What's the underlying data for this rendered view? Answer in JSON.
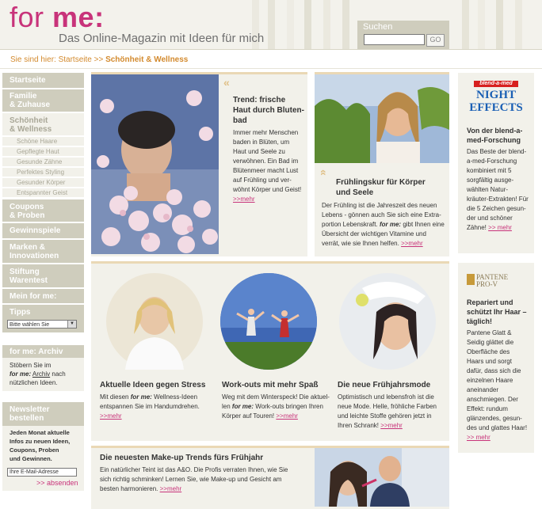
{
  "header": {
    "logo_left": "for",
    "logo_right": "me:",
    "tagline": "Das Online-Magazin mit Ideen für mich",
    "search_label": "Suchen",
    "search_button": "GO"
  },
  "breadcrumb": {
    "prefix": "Sie sind hier: Startseite >> ",
    "current": "Schönheit & Wellness"
  },
  "sidebar": {
    "startseite": "Startseite",
    "familie_1": "Familie",
    "familie_2": "& Zuhause",
    "schoenheit_1": "Schönheit",
    "schoenheit_2": "& Wellness",
    "subs": [
      "Schöne Haare",
      "Gepflegte Haut",
      "Gesunde Zähne",
      "Perfektes Styling",
      "Gesunder Körper",
      "Entspannter Geist"
    ],
    "coupons_1": "Coupons",
    "coupons_2": "& Proben",
    "gewinnspiele": "Gewinnspiele",
    "marken_1": "Marken &",
    "marken_2": "Innovationen",
    "stiftung_1": "Stiftung",
    "stiftung_2": "Warentest",
    "meinforme": "Mein for me:",
    "tipps": "Tipps",
    "tipps_select": "Bitte wählen Sie",
    "archiv_head": "for me: Archiv",
    "archiv_1": "Stöbern Sie im",
    "archiv_2a": "for me:",
    "archiv_2b": "Archiv",
    "archiv_2c": "nach",
    "archiv_3": "nützlichen Ideen.",
    "nl_head_1": "Newsletter",
    "nl_head_2": "bestellen",
    "nl_text": [
      "Jeden Monat aktuelle",
      "Infos zu neuen Ideen,",
      "Coupons, Proben",
      "und Gewinnen."
    ],
    "nl_input": "Ihre E-Mail-Adresse",
    "nl_submit": ">> absenden"
  },
  "articles": {
    "trend": {
      "title": [
        "Trend: frische",
        "Haut durch Bluten-",
        "bad"
      ],
      "text": [
        "Immer mehr Menschen",
        "baden in Blüten, um",
        "Haut und Seele zu",
        "verwöhnen. Ein Bad im",
        "Blütenmeer macht Lust",
        "auf Frühling und ver-",
        "wöhnt Körper und Geist!"
      ],
      "more": ">>mehr"
    },
    "fruehling": {
      "title": [
        "Frühlingskur für Körper",
        "und Seele"
      ],
      "text": [
        "Der Frühling ist die Jahreszeit des neuen",
        "Lebens - gönnen auch Sie sich eine Extra-",
        "portion Lebenskraft."
      ],
      "text_formee": "for me:",
      "text_after": "gibt Ihnen eine",
      "text2": [
        "Übersicht der wichtigen Vitamine und",
        "verrät, wie sie Ihnen helfen."
      ],
      "more": ">>mehr"
    },
    "stress": {
      "title": "Aktuelle Ideen gegen Stress",
      "text_a": "Mit diesen",
      "text_formee": "for me:",
      "text_b": "Wellness-Ideen",
      "text2": "entspannen Sie im Handumdrehen.",
      "more": ">>mehr"
    },
    "workouts": {
      "title": "Work-outs mit mehr Spaß",
      "text1": "Weg mit dem Winterspeck! Die aktuel-",
      "text2a": "len",
      "text_formee": "for me:",
      "text2b": "Work-outs bringen Ihren",
      "text3": "Körper auf Touren!",
      "more": ">>mehr"
    },
    "fruehjahrsmode": {
      "title": "Die neue Frühjahrsmode",
      "text": [
        "Optimistisch und lebensfroh ist die",
        "neue Mode. Helle, fröhliche Farben",
        "und leichte Stoffe gehören jetzt in",
        "Ihren Schrank!"
      ],
      "more": ">>mehr"
    },
    "makeup": {
      "title": "Die neuesten Make-up Trends fürs Frühjahr",
      "text": [
        "Ein natürlicher Teint ist das A&O. Die Profis verraten Ihnen, wie Sie",
        "sich richtig schminken! Lernen Sie, wie Make-up und Gesicht am",
        "besten harmonieren."
      ],
      "more": ">>mehr"
    }
  },
  "ads": {
    "blendamed": {
      "brand": "blend-a-med",
      "product_1": "NIGHT",
      "product_2": "EFFECTS",
      "title": [
        "Von der blend-a-",
        "med-Forschung"
      ],
      "text": [
        "Das Beste der blend-",
        "a-med-Forschung",
        "kombiniert mit 5",
        "sorgfältig ausge-",
        "wählten Natur-",
        "kräuter-Extrakten! Für",
        "die 5 Zeichen gesun-",
        "der und schöner",
        "Zähne!"
      ],
      "more": ">> mehr"
    },
    "pantene": {
      "brand": "PANTENE",
      "brand2": "PRO-V",
      "title": [
        "Repariert und",
        "schützt Ihr Haar –",
        "täglich!"
      ],
      "text": [
        "Pantene Glatt &",
        "Seidig glättet die",
        "Oberfläche des",
        "Haars und sorgt",
        "dafür, dass sich die",
        "einzelnen Haare",
        "aneinander",
        "anschmiegen. Der",
        "Effekt: rundum",
        "glänzendes, gesun-",
        "des und glattes Haar!"
      ],
      "more": ">> mehr"
    }
  },
  "colors": {
    "brand": "#c8337a",
    "accent": "#d38a2e",
    "nav": "#cfcdbd",
    "card": "#f2f1ea"
  }
}
